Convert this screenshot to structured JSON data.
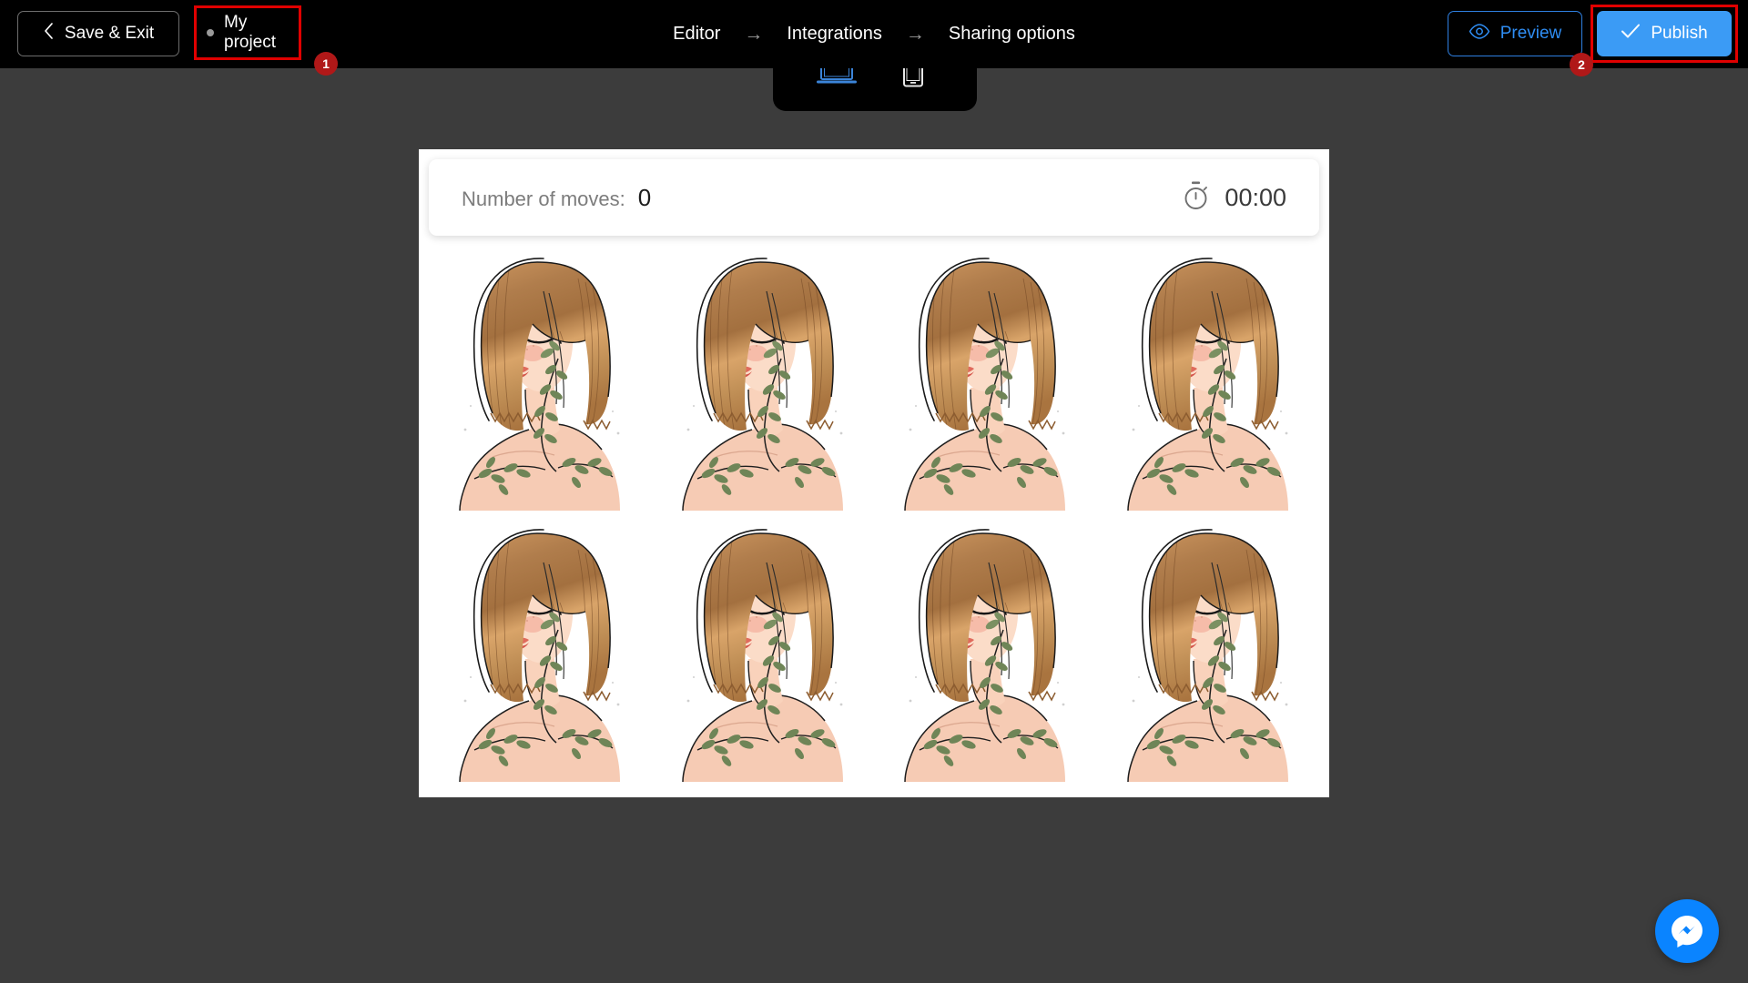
{
  "topbar": {
    "save_exit_label": "Save & Exit",
    "save_exit_icon": "chevron-left-icon",
    "project_name": "My project",
    "project_status_icon": "status-dot-icon",
    "preview_label": "Preview",
    "preview_icon": "eye-icon",
    "publish_label": "Publish",
    "publish_icon": "check-icon",
    "publish_bg_color": "#3b9bf5",
    "preview_accent_color": "#2f8ef5",
    "background_color": "#000000"
  },
  "breadcrumb": {
    "separator": "→",
    "items": [
      {
        "label": "Editor"
      },
      {
        "label": "Integrations"
      },
      {
        "label": "Sharing options"
      }
    ]
  },
  "device_toggle": {
    "desktop_icon": "desktop-icon",
    "mobile_icon": "mobile-icon",
    "active": "desktop",
    "active_color": "#3b84d8",
    "inactive_color": "#e8e8e8"
  },
  "annotations": [
    {
      "number": "1",
      "target": "project-chip",
      "color": "#e00000"
    },
    {
      "number": "2",
      "target": "publish-button",
      "color": "#e00000"
    }
  ],
  "canvas": {
    "background_color": "#ffffff",
    "page_background_color": "#3c3c3c",
    "game_header": {
      "moves_label": "Number of moves:",
      "moves_value": "0",
      "timer_icon": "stopwatch-icon",
      "timer_value": "00:00"
    },
    "grid": {
      "columns": 4,
      "rows": 2,
      "cards": [
        {
          "id": "card-1",
          "face": "woman-with-leaves-illustration",
          "state": "face-up"
        },
        {
          "id": "card-2",
          "face": "woman-with-leaves-illustration",
          "state": "face-up"
        },
        {
          "id": "card-3",
          "face": "woman-with-leaves-illustration",
          "state": "face-up"
        },
        {
          "id": "card-4",
          "face": "woman-with-leaves-illustration",
          "state": "face-up"
        },
        {
          "id": "card-5",
          "face": "woman-with-leaves-illustration",
          "state": "face-up"
        },
        {
          "id": "card-6",
          "face": "woman-with-leaves-illustration",
          "state": "face-up"
        },
        {
          "id": "card-7",
          "face": "woman-with-leaves-illustration",
          "state": "face-up"
        },
        {
          "id": "card-8",
          "face": "woman-with-leaves-illustration",
          "state": "face-up"
        }
      ]
    }
  },
  "chat_widget": {
    "icon": "messenger-icon",
    "color": "#0a84ff"
  }
}
